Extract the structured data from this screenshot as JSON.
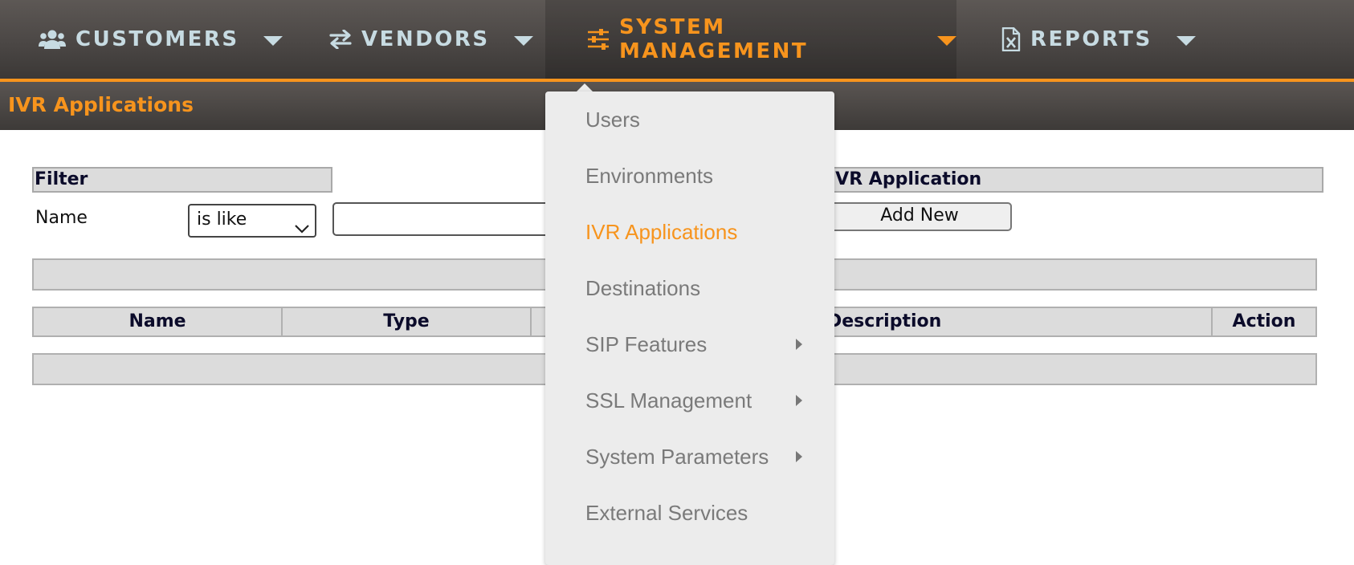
{
  "nav": {
    "items": [
      {
        "label": "CUSTOMERS",
        "icon": "users-icon"
      },
      {
        "label": "VENDORS",
        "icon": "exchange-arrows-icon"
      },
      {
        "label": "SYSTEM MANAGEMENT",
        "icon": "sliders-icon"
      },
      {
        "label": "REPORTS",
        "icon": "excel-file-icon"
      }
    ],
    "active_index": 2
  },
  "page": {
    "title": "IVR Applications"
  },
  "filter": {
    "header": "Filter",
    "name_label": "Name",
    "operator_value": "is like",
    "name_value": ""
  },
  "ivr_application": {
    "header": "IVR Application",
    "add_button": "Add New"
  },
  "table": {
    "columns": [
      "Name",
      "Type",
      "",
      "Description",
      "Action"
    ],
    "rows": []
  },
  "dropdown": {
    "items": [
      {
        "label": "Users",
        "has_submenu": false
      },
      {
        "label": "Environments",
        "has_submenu": false
      },
      {
        "label": "IVR Applications",
        "has_submenu": false,
        "active": true
      },
      {
        "label": "Destinations",
        "has_submenu": false
      },
      {
        "label": "SIP Features",
        "has_submenu": true
      },
      {
        "label": "SSL Management",
        "has_submenu": true
      },
      {
        "label": "System Parameters",
        "has_submenu": true
      },
      {
        "label": "External Services",
        "has_submenu": false
      }
    ]
  },
  "colors": {
    "accent": "#f7941d",
    "nav_text": "#c7dbe2",
    "nav_background": "#4b4745",
    "menu_text": "#7a7a7a",
    "menu_background": "#ececec"
  }
}
